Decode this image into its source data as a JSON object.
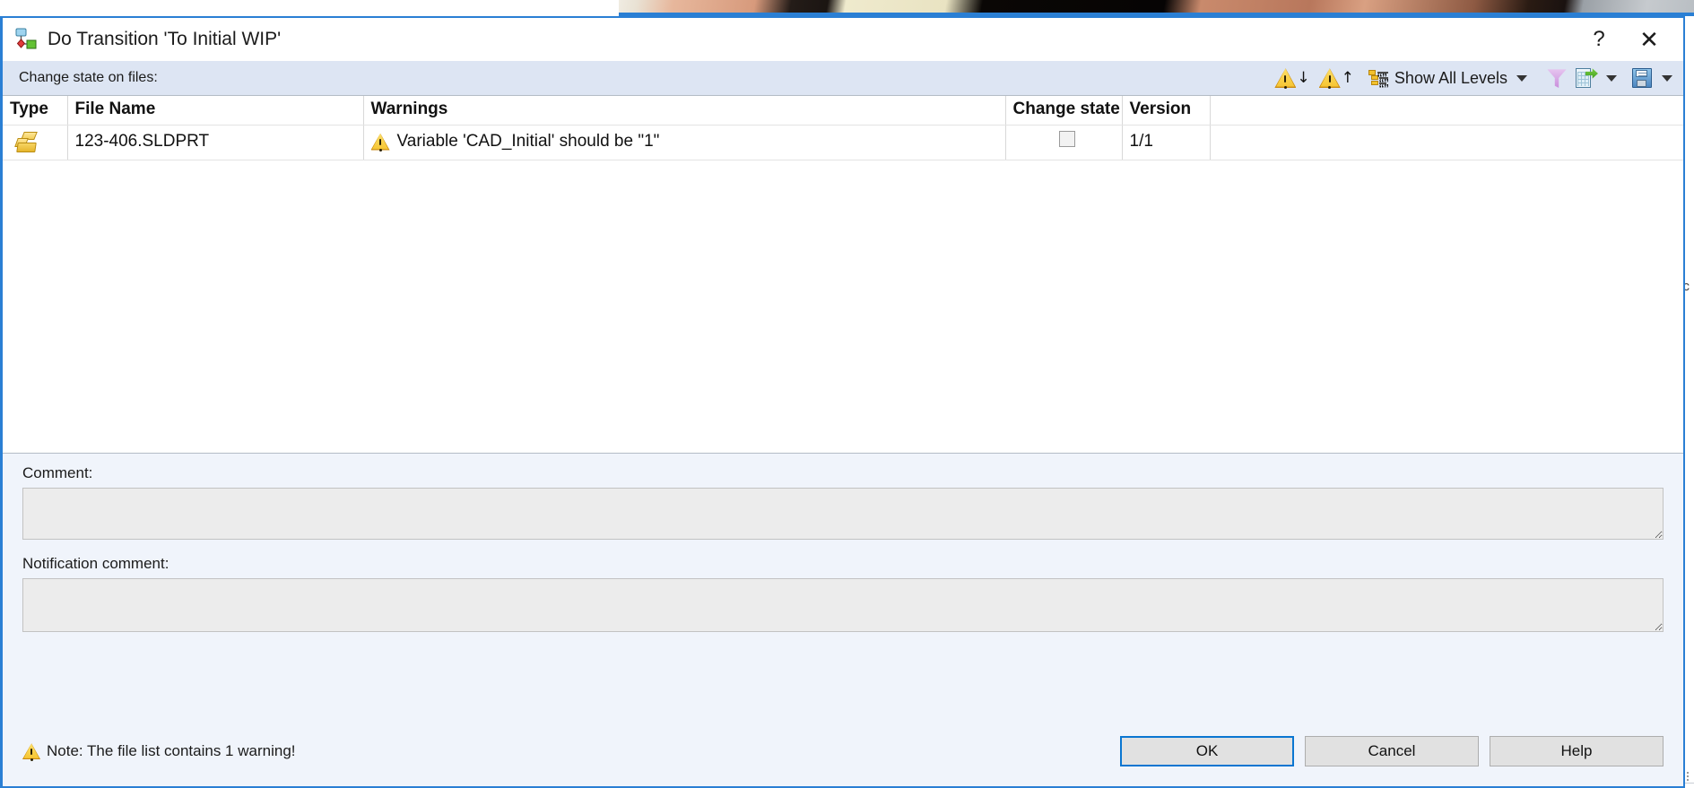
{
  "dialog": {
    "title": "Do Transition 'To Initial WIP'",
    "title_icon": "workflow-transition-icon",
    "help_button": "?",
    "close_button": "✕"
  },
  "toolbar": {
    "label": "Change state on files:",
    "prev_warning_icon": "warning-down-icon",
    "prev_warning_arrow": "↓",
    "next_warning_icon": "warning-up-icon",
    "next_warning_arrow": "↑",
    "levels_label": "Show All Levels",
    "levels_icon": "list-levels-icon",
    "filter_icon": "funnel-filter-icon",
    "export_icon": "export-to-spreadsheet-icon",
    "save_icon": "save-floppy-icon"
  },
  "filelist": {
    "columns": [
      {
        "key": "type",
        "label": "Type"
      },
      {
        "key": "name",
        "label": "File Name"
      },
      {
        "key": "warnings",
        "label": "Warnings"
      },
      {
        "key": "change_state",
        "label": "Change state"
      },
      {
        "key": "version",
        "label": "Version"
      }
    ],
    "rows": [
      {
        "type_icon": "sldprt-part-icon",
        "name": "123-406.SLDPRT",
        "warning_icon": "warning-triangle-icon",
        "warning": "Variable 'CAD_Initial' should be \"1\"",
        "change_state_checked": false,
        "version": "1/1"
      }
    ]
  },
  "comment": {
    "label": "Comment:",
    "value": "",
    "placeholder": ""
  },
  "notification_comment": {
    "label": "Notification comment:",
    "value": "",
    "placeholder": ""
  },
  "footer": {
    "note_icon": "warning-triangle-icon",
    "note": "Note: The file list contains 1 warning!",
    "ok_label": "OK",
    "cancel_label": "Cancel",
    "help_label": "Help"
  },
  "background": {
    "side_text": "о\nc\nu\nu\nt\nc"
  },
  "colors": {
    "dialog_border": "#2a7fd4",
    "toolbar_bg": "#dde5f3",
    "panel_bg": "#f0f4fb",
    "warning_yellow": "#f6c430",
    "accent": "#0a76d1"
  }
}
